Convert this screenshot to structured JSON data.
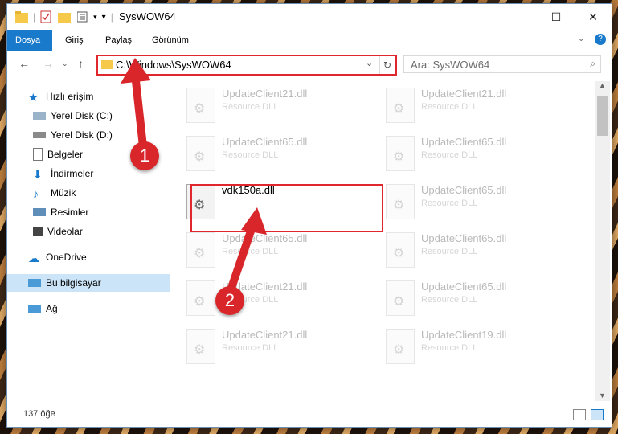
{
  "window": {
    "title": "SysWOW64"
  },
  "ribbon": {
    "tabs": [
      "Dosya",
      "Giriş",
      "Paylaş",
      "Görünüm"
    ]
  },
  "address": {
    "path": "C:\\Windows\\SysWOW64"
  },
  "search": {
    "placeholder": "Ara: SysWOW64"
  },
  "sidebar": {
    "items": [
      {
        "label": "Hızlı erişim"
      },
      {
        "label": "Yerel Disk (C:)"
      },
      {
        "label": "Yerel Disk (D:)"
      },
      {
        "label": "Belgeler"
      },
      {
        "label": "İndirmeler"
      },
      {
        "label": "Müzik"
      },
      {
        "label": "Resimler"
      },
      {
        "label": "Videolar"
      },
      {
        "label": "OneDrive"
      },
      {
        "label": "Bu bilgisayar"
      },
      {
        "label": "Ağ"
      }
    ]
  },
  "files": {
    "left": [
      {
        "name": "UpdateClient21.dll",
        "type": "Resource DLL"
      },
      {
        "name": "UpdateClient65.dll",
        "type": "Resource DLL"
      },
      {
        "name": "vdk150a.dll",
        "type": ""
      },
      {
        "name": "UpdateClient65.dll",
        "type": "Resource DLL"
      },
      {
        "name": "UpdateClient21.dll",
        "type": "Resource DLL"
      },
      {
        "name": "UpdateClient21.dll",
        "type": "Resource DLL"
      }
    ],
    "right": [
      {
        "name": "UpdateClient21.dll",
        "type": "Resource DLL"
      },
      {
        "name": "UpdateClient65.dll",
        "type": "Resource DLL"
      },
      {
        "name": "UpdateClient65.dll",
        "type": "Resource DLL"
      },
      {
        "name": "UpdateClient65.dll",
        "type": "Resource DLL"
      },
      {
        "name": "UpdateClient65.dll",
        "type": "Resource DLL"
      },
      {
        "name": "UpdateClient19.dll",
        "type": "Resource DLL"
      }
    ]
  },
  "status": {
    "count": "137 öğe"
  },
  "annotations": {
    "step1": "1",
    "step2": "2"
  }
}
